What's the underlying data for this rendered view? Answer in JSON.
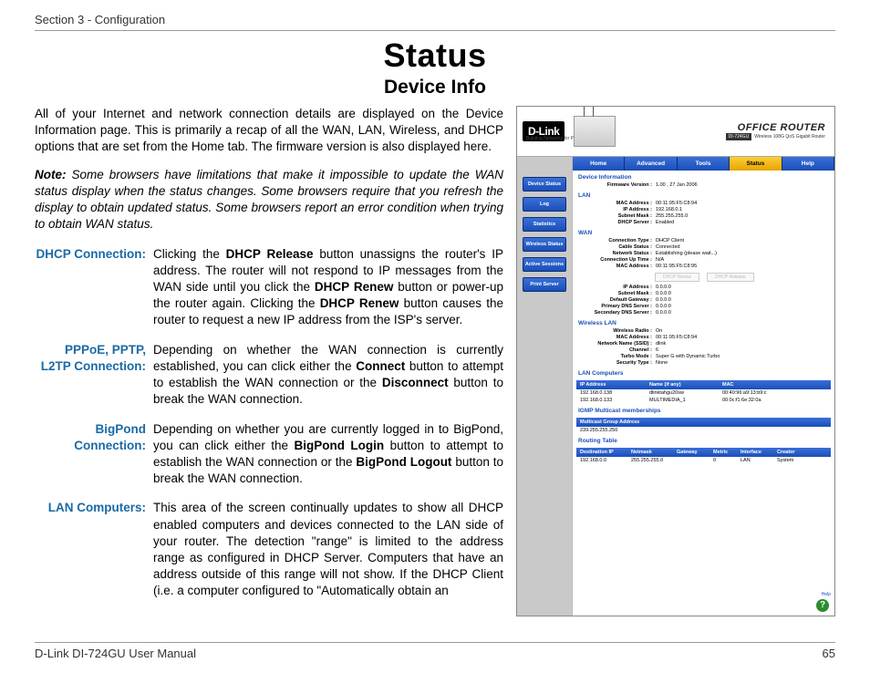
{
  "header": {
    "section": "Section 3 - Configuration"
  },
  "titles": {
    "main": "Status",
    "sub": "Device Info"
  },
  "body": {
    "intro": "All of your Internet and network connection details are displayed on the Device Information page. This is primarily a recap of all the WAN, LAN, Wireless, and DHCP options that are set from the Home tab. The firmware version is also displayed here.",
    "note_label": "Note: ",
    "note_text": "Some browsers have limitations that make it impossible to update the WAN status display when the status changes. Some browsers require that you refresh the display to obtain updated status. Some browsers report an error condition when trying to obtain WAN status."
  },
  "defs": [
    {
      "term": "DHCP Connection:",
      "p1": "Clicking the",
      "b1": "DHCP Release",
      "p2": "button unassigns the router's IP address. The router will not respond to IP messages from the WAN side until you click the",
      "b2": "DHCP Renew",
      "p3": "button or power-up the router again. Clicking the",
      "b3": "DHCP Renew",
      "p4": "button causes the router to request a new IP address from the ISP's server."
    },
    {
      "term": "PPPoE, PPTP, L2TP Connection:",
      "p1": "Depending on whether the WAN connection is currently established, you can click either the",
      "b1": "Connect",
      "p2": "button to attempt to establish the WAN connection or the",
      "b2": "Disconnect",
      "p3": "button to break the WAN connection."
    },
    {
      "term": "BigPond Connection:",
      "p1": "Depending on whether you are currently logged in to BigPond, you can click either the",
      "b1": "BigPond Login",
      "p2": "button to attempt to establish the WAN connection or the",
      "b2": "BigPond Logout",
      "p3": "button to break the WAN connection."
    },
    {
      "term": "LAN Computers:",
      "p1": "This area of the screen continually updates to show all DHCP enabled computers and devices connected to the LAN side of your router. The detection \"range\" is limited to the address range as configured in DHCP Server. Computers that have an address outside of this range will not show. If the DHCP Client (i.e. a computer configured to \"Automatically obtain an"
    }
  ],
  "shot": {
    "brand": "D-Link",
    "tagline": "Building Networks for People",
    "product_title": "OFFICE ROUTER",
    "model": "DI-724GU",
    "product_sub": "Wireless 108G QoS Gigabit Router",
    "tabs": [
      "Home",
      "Advanced",
      "Tools",
      "Status",
      "Help"
    ],
    "side": [
      "Device Status",
      "Log",
      "Statistics",
      "Wireless Status",
      "Active Sessions",
      "Print Server"
    ],
    "sections": {
      "device_info": "Device Information",
      "lan": "LAN",
      "wan": "WAN",
      "wlan": "Wireless LAN",
      "lanc": "LAN Computers",
      "igmp": "IGMP Multicast memberships",
      "routing": "Routing Table"
    },
    "kv": {
      "fw_k": "Firmware Version :",
      "fw_v": "1.00 ,   27 Jan 2006",
      "lan_mac_k": "MAC Address :",
      "lan_mac_v": "00:11:95:F5:C8:94",
      "lan_ip_k": "IP Address :",
      "lan_ip_v": "192.168.0.1",
      "lan_mask_k": "Subnet Mask :",
      "lan_mask_v": "255.255.255.0",
      "lan_dhcp_k": "DHCP Server :",
      "lan_dhcp_v": "Enabled",
      "wan_ct_k": "Connection Type :",
      "wan_ct_v": "DHCP Client",
      "wan_cs_k": "Cable Status :",
      "wan_cs_v": "Connected",
      "wan_ns_k": "Network Status :",
      "wan_ns_v": "Establishing (please wait...)",
      "wan_up_k": "Connection Up Time :",
      "wan_up_v": "N/A",
      "wan_mac_k": "MAC Address :",
      "wan_mac_v": "00:11:95:F5:C8:95",
      "wan_ip_k": "IP Address :",
      "wan_ip_v": "0.0.0.0",
      "wan_mask_k": "Subnet Mask :",
      "wan_mask_v": "0.0.0.0",
      "wan_gw_k": "Default Gateway :",
      "wan_gw_v": "0.0.0.0",
      "wan_dns1_k": "Primary DNS Server :",
      "wan_dns1_v": "0.0.0.0",
      "wan_dns2_k": "Secondary DNS Server :",
      "wan_dns2_v": "0.0.0.0",
      "w_radio_k": "Wireless Radio :",
      "w_radio_v": "On",
      "w_mac_k": "MAC Address :",
      "w_mac_v": "00:11:95:F5:C8:94",
      "w_ssid_k": "Network Name (SSID) :",
      "w_ssid_v": "dlink",
      "w_ch_k": "Channel :",
      "w_ch_v": "6",
      "w_turbo_k": "Turbo Mode :",
      "w_turbo_v": "Super G with Dynamic Turbo",
      "w_sec_k": "Security Type :",
      "w_sec_v": "None"
    },
    "buttons": {
      "renew": "DHCP Renew",
      "release": "DHCP Release"
    },
    "lanc": {
      "head": [
        "IP Address",
        "Name (if any)",
        "MAC"
      ],
      "rows": [
        [
          "192.168.0.138",
          "dlinktahgu20sw",
          "00:40:96:a9:13:b9:c"
        ],
        [
          "192.168.0.133",
          "MULTIMEDIA_1",
          "00:0c:f1:6e:32:0a"
        ]
      ]
    },
    "igmp": {
      "head": "Multicast Group Address",
      "row": "239.255.255.250"
    },
    "routing": {
      "head": [
        "Destination IP",
        "Netmask",
        "Gateway",
        "Metric",
        "Interface",
        "Creator"
      ],
      "row": [
        "192.168.0.0",
        "255.255.255.0",
        "",
        "0",
        "LAN",
        "System"
      ]
    },
    "help_label": "Help"
  },
  "footer": {
    "doc": "D-Link DI-724GU User Manual",
    "page": "65"
  }
}
